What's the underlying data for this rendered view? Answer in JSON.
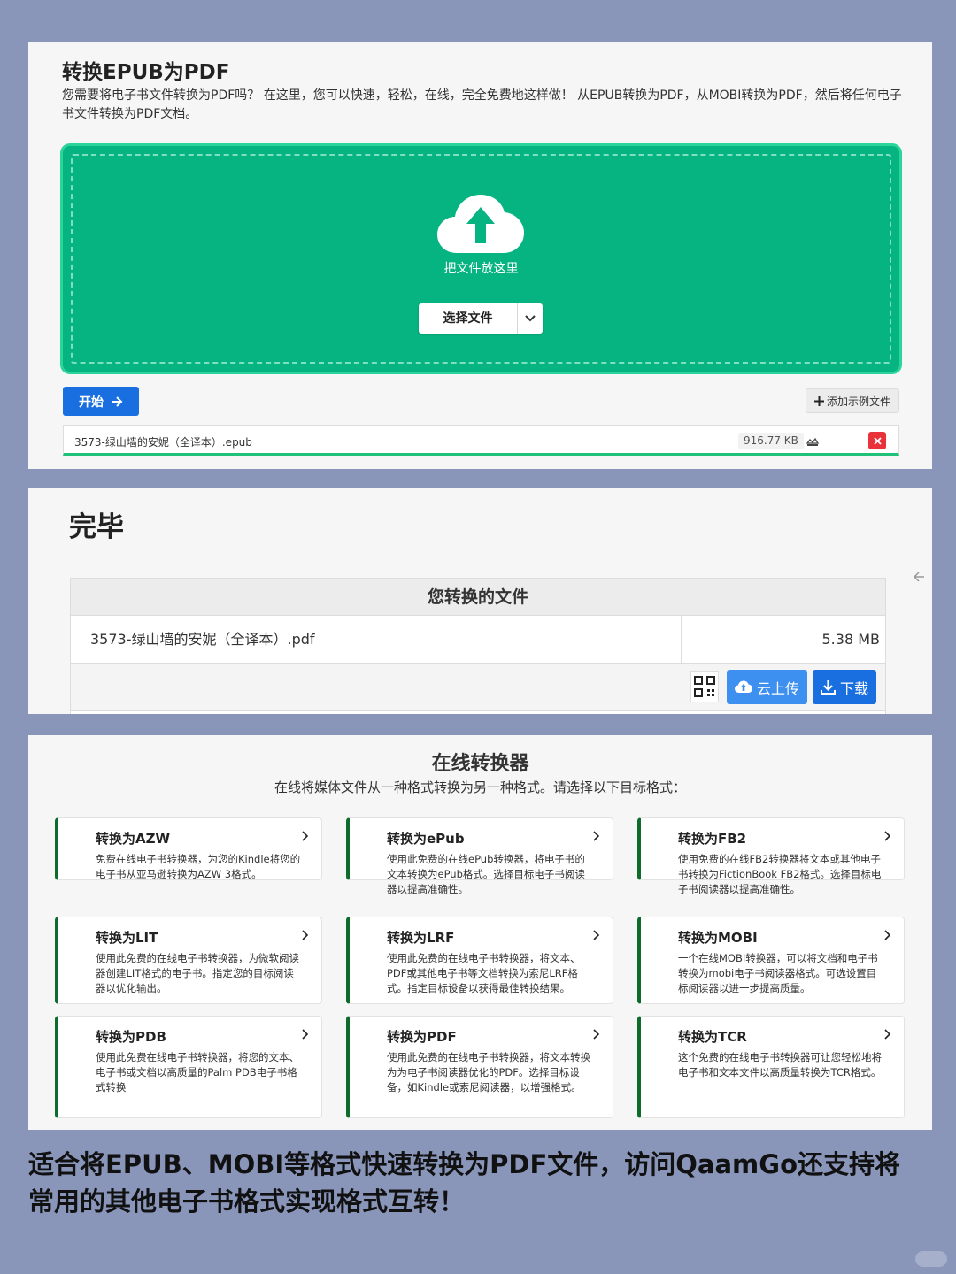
{
  "upload": {
    "title": "转换EPUB为PDF",
    "description": "您需要将电子书文件转换为PDF吗？ 在这里，您可以快速，轻松，在线，完全免费地这样做！ 从EPUB转换为PDF，从MOBI转换为PDF，然后将任何电子书文件转换为PDF文档。",
    "drop_hint": "把文件放这里",
    "choose_label": "选择文件",
    "start_label": "开始",
    "sample_label": "添加示例文件",
    "file_name": "3573-绿山墙的安妮（全译本）.epub",
    "file_size": "916.77 KB",
    "accent_color": "#06b481"
  },
  "result": {
    "done_title": "完毕",
    "table_header": "您转换的文件",
    "file_name": "3573-绿山墙的安妮（全译本）.pdf",
    "file_size": "5.38 MB",
    "cloud_label": "云上传",
    "download_label": "下载"
  },
  "converters": {
    "title": "在线转换器",
    "subtitle": "在线将媒体文件从一种格式转换为另一种格式。请选择以下目标格式：",
    "cards": [
      {
        "title": "转换为AZW",
        "desc": "免费在线电子书转换器，为您的Kindle将您的电子书从亚马逊转换为AZW 3格式。"
      },
      {
        "title": "转换为ePub",
        "desc": "使用此免费的在线ePub转换器，将电子书的文本转换为ePub格式。选择目标电子书阅读器以提高准确性。"
      },
      {
        "title": "转换为FB2",
        "desc": "使用免费的在线FB2转换器将文本或其他电子书转换为FictionBook FB2格式。选择目标电子书阅读器以提高准确性。"
      },
      {
        "title": "转换为LIT",
        "desc": "使用此免费的在线电子书转换器，为微软阅读器创建LIT格式的电子书。指定您的目标阅读器以优化输出。"
      },
      {
        "title": "转换为LRF",
        "desc": "使用此免费的在线电子书转换器，将文本、PDF或其他电子书等文档转换为索尼LRF格式。指定目标设备以获得最佳转换结果。"
      },
      {
        "title": "转换为MOBI",
        "desc": "一个在线MOBI转换器，可以将文档和电子书转换为mobi电子书阅读器格式。可选设置目标阅读器以进一步提高质量。"
      },
      {
        "title": "转换为PDB",
        "desc": "使用此免费在线电子书转换器，将您的文本、电子书或文档以高质量的Palm PDB电子书格式转换"
      },
      {
        "title": "转换为PDF",
        "desc": "使用此免费的在线电子书转换器，将文本转换为为电子书阅读器优化的PDF。选择目标设备，如Kindle或索尼阅读器，以增强格式。"
      },
      {
        "title": "转换为TCR",
        "desc": "这个免费的在线电子书转换器可让您轻松地将电子书和文本文件以高质量转换为TCR格式。"
      }
    ]
  },
  "caption": "适合将EPUB、MOBI等格式快速转换为PDF文件，访问QaamGo还支持将常用的其他电子书格式实现格式互转！"
}
